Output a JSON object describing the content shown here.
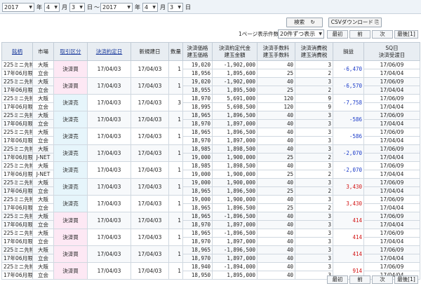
{
  "date_filter": {
    "from_year": "2017",
    "year_label": "年",
    "from_month": "4",
    "month_label": "月",
    "from_day": "3",
    "day_label": "日",
    "range_sep": "～",
    "to_year": "2017",
    "to_month": "4",
    "to_day": "3"
  },
  "actions": {
    "search": "検索",
    "search_icon": "↻",
    "csv": "CSVダウンロード",
    "csv_icon": "⎘"
  },
  "paging": {
    "per_page_label": "1ページ表示件数",
    "per_page_value": "20件ずつ表示",
    "first": "最初",
    "prev": "前",
    "next": "次",
    "last": "最後[1]"
  },
  "columns": {
    "symbol": "銘柄",
    "market": "市場",
    "trade_type": "取引区分",
    "settle_date": "決済約定日",
    "open_date": "新規建日",
    "qty": "数量",
    "price_top": "決済価格",
    "price_bot": "建玉価格",
    "amount_top": "決済約定代金",
    "amount_bot": "建玉金額",
    "fee_top": "決済手数料",
    "fee_bot": "建玉手数料",
    "tax_top": "決済消費税",
    "tax_bot": "建玉消費税",
    "pnl": "損益",
    "sq_top": "SQ日",
    "sq_bot": "決済受渡日"
  },
  "rows": [
    {
      "sym1": "225ミニ先物",
      "sym2": "17年06月限",
      "mk1": "大阪",
      "mk2": "立会",
      "kind": "決済買",
      "kc": "kbuy",
      "sd": "17/04/03",
      "od": "17/04/03",
      "qty": "1",
      "p1": "19,020",
      "p2": "18,956",
      "a1": "-1,902,000",
      "a2": "1,895,600",
      "f1": "40",
      "f2": "25",
      "t1": "3",
      "t2": "2",
      "pnl": "-6,470",
      "pc": "blue",
      "sq1": "17/06/09",
      "sq2": "17/04/04"
    },
    {
      "sym1": "225ミニ先物",
      "sym2": "17年06月限",
      "mk1": "大阪",
      "mk2": "立会",
      "kind": "決済買",
      "kc": "kbuy",
      "sd": "17/04/03",
      "od": "17/04/03",
      "qty": "1",
      "p1": "19,020",
      "p2": "18,955",
      "a1": "-1,902,000",
      "a2": "1,895,500",
      "f1": "40",
      "f2": "25",
      "t1": "3",
      "t2": "2",
      "pnl": "-6,570",
      "pc": "blue",
      "sq1": "17/06/09",
      "sq2": "17/04/04"
    },
    {
      "sym1": "225ミニ先物",
      "sym2": "17年06月限",
      "mk1": "大阪",
      "mk2": "立会",
      "kind": "決済売",
      "kc": "ksell",
      "sd": "17/04/03",
      "od": "17/04/03",
      "qty": "3",
      "p1": "18,970",
      "p2": "18,995",
      "a1": "5,691,000",
      "a2": "5,698,500",
      "f1": "120",
      "f2": "120",
      "t1": "9",
      "t2": "9",
      "pnl": "-7,758",
      "pc": "blue",
      "sq1": "17/06/09",
      "sq2": "17/04/04"
    },
    {
      "sym1": "225ミニ先物",
      "sym2": "17年06月限",
      "mk1": "大阪",
      "mk2": "立会",
      "kind": "決済売",
      "kc": "ksell",
      "sd": "17/04/03",
      "od": "17/04/03",
      "qty": "1",
      "p1": "18,965",
      "p2": "18,970",
      "a1": "1,896,500",
      "a2": "1,897,000",
      "f1": "40",
      "f2": "40",
      "t1": "3",
      "t2": "3",
      "pnl": "-586",
      "pc": "blue",
      "sq1": "17/06/09",
      "sq2": "17/04/04"
    },
    {
      "sym1": "225ミニ先物",
      "sym2": "17年06月限",
      "mk1": "大阪",
      "mk2": "立会",
      "kind": "決済売",
      "kc": "ksell",
      "sd": "17/04/03",
      "od": "17/04/03",
      "qty": "1",
      "p1": "18,965",
      "p2": "18,970",
      "a1": "1,896,500",
      "a2": "1,897,000",
      "f1": "40",
      "f2": "40",
      "t1": "3",
      "t2": "3",
      "pnl": "-586",
      "pc": "blue",
      "sq1": "17/06/09",
      "sq2": "17/04/04"
    },
    {
      "sym1": "225ミニ先物",
      "sym2": "17年06月限",
      "mk1": "大阪",
      "mk2": "J-NET",
      "kind": "決済売",
      "kc": "ksell",
      "sd": "17/04/03",
      "od": "17/04/03",
      "qty": "1",
      "p1": "18,985",
      "p2": "19,000",
      "a1": "1,898,500",
      "a2": "1,900,000",
      "f1": "40",
      "f2": "25",
      "t1": "3",
      "t2": "2",
      "pnl": "-2,070",
      "pc": "blue",
      "sq1": "17/06/09",
      "sq2": "17/04/04"
    },
    {
      "sym1": "225ミニ先物",
      "sym2": "17年06月限",
      "mk1": "大阪",
      "mk2": "J-NET",
      "kind": "決済売",
      "kc": "ksell",
      "sd": "17/04/03",
      "od": "17/04/03",
      "qty": "1",
      "p1": "18,985",
      "p2": "19,000",
      "a1": "1,898,500",
      "a2": "1,900,000",
      "f1": "40",
      "f2": "25",
      "t1": "3",
      "t2": "2",
      "pnl": "-2,070",
      "pc": "blue",
      "sq1": "17/06/09",
      "sq2": "17/04/04"
    },
    {
      "sym1": "225ミニ先物",
      "sym2": "17年06月限",
      "mk1": "大阪",
      "mk2": "立会",
      "kind": "決済売",
      "kc": "ksell",
      "sd": "17/04/03",
      "od": "17/04/03",
      "qty": "1",
      "p1": "19,000",
      "p2": "18,965",
      "a1": "1,900,000",
      "a2": "1,896,500",
      "f1": "40",
      "f2": "25",
      "t1": "3",
      "t2": "2",
      "pnl": "3,430",
      "pc": "red",
      "sq1": "17/06/09",
      "sq2": "17/04/04"
    },
    {
      "sym1": "225ミニ先物",
      "sym2": "17年06月限",
      "mk1": "大阪",
      "mk2": "立会",
      "kind": "決済売",
      "kc": "ksell",
      "sd": "17/04/03",
      "od": "17/04/03",
      "qty": "1",
      "p1": "19,000",
      "p2": "18,965",
      "a1": "1,900,000",
      "a2": "1,896,500",
      "f1": "40",
      "f2": "25",
      "t1": "3",
      "t2": "2",
      "pnl": "3,430",
      "pc": "red",
      "sq1": "17/06/09",
      "sq2": "17/04/04"
    },
    {
      "sym1": "225ミニ先物",
      "sym2": "17年06月限",
      "mk1": "大阪",
      "mk2": "立会",
      "kind": "決済買",
      "kc": "kbuy",
      "sd": "17/04/03",
      "od": "17/04/03",
      "qty": "1",
      "p1": "18,965",
      "p2": "18,970",
      "a1": "-1,896,500",
      "a2": "1,897,000",
      "f1": "40",
      "f2": "40",
      "t1": "3",
      "t2": "3",
      "pnl": "414",
      "pc": "red",
      "sq1": "17/06/09",
      "sq2": "17/04/04"
    },
    {
      "sym1": "225ミニ先物",
      "sym2": "17年06月限",
      "mk1": "大阪",
      "mk2": "立会",
      "kind": "決済買",
      "kc": "kbuy",
      "sd": "17/04/03",
      "od": "17/04/03",
      "qty": "1",
      "p1": "18,965",
      "p2": "18,970",
      "a1": "-1,896,500",
      "a2": "1,897,000",
      "f1": "40",
      "f2": "40",
      "t1": "3",
      "t2": "3",
      "pnl": "414",
      "pc": "red",
      "sq1": "17/06/09",
      "sq2": "17/04/04"
    },
    {
      "sym1": "225ミニ先物",
      "sym2": "17年06月限",
      "mk1": "大阪",
      "mk2": "立会",
      "kind": "決済買",
      "kc": "kbuy",
      "sd": "17/04/03",
      "od": "17/04/03",
      "qty": "1",
      "p1": "18,965",
      "p2": "18,970",
      "a1": "-1,896,500",
      "a2": "1,897,000",
      "f1": "40",
      "f2": "40",
      "t1": "3",
      "t2": "3",
      "pnl": "414",
      "pc": "red",
      "sq1": "17/06/09",
      "sq2": "17/04/04"
    },
    {
      "sym1": "225ミニ先物",
      "sym2": "17年06月限",
      "mk1": "大阪",
      "mk2": "立会",
      "kind": "決済買",
      "kc": "kbuy",
      "sd": "17/04/03",
      "od": "17/04/03",
      "qty": "1",
      "p1": "18,940",
      "p2": "18,950",
      "a1": "-1,894,000",
      "a2": "1,895,000",
      "f1": "40",
      "f2": "40",
      "t1": "3",
      "t2": "3",
      "pnl": "914",
      "pc": "red",
      "sq1": "17/06/09",
      "sq2": "17/04/04"
    }
  ],
  "colors": {
    "header_bg": "#e8edf2",
    "buy_bg": "#fde8f4",
    "sell_bg": "#e6f5fb",
    "loss": "#1a3ac8",
    "profit": "#d21414"
  }
}
